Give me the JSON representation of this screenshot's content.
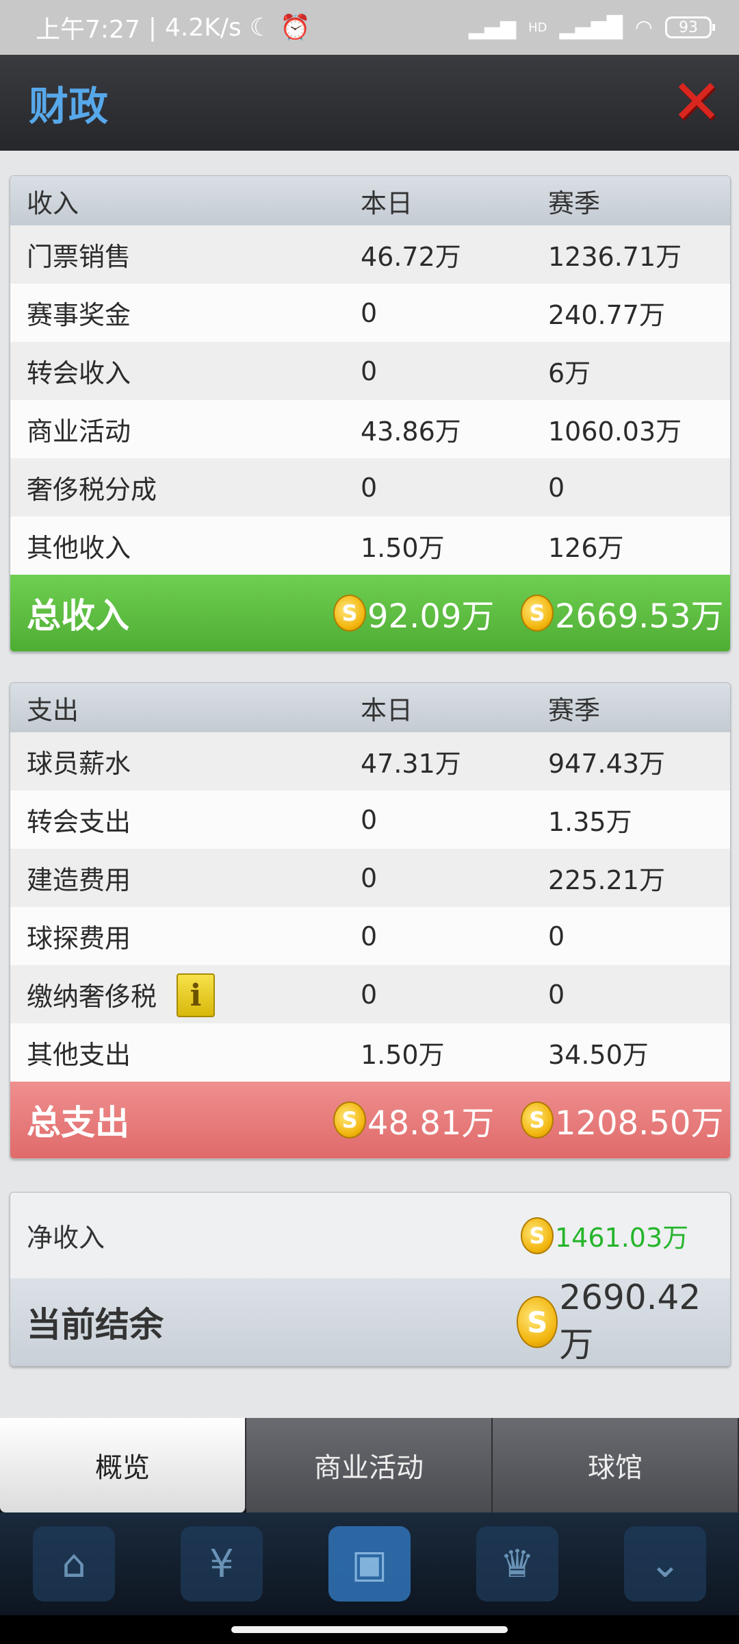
{
  "status_bar": {
    "time": "上午7:27",
    "speed": "4.2K/s",
    "battery": "93",
    "network": "HD"
  },
  "header": {
    "title": "财政"
  },
  "income": {
    "headers": [
      "收入",
      "本日",
      "赛季"
    ],
    "rows": [
      {
        "label": "门票销售",
        "day": "46.72万",
        "season": "1236.71万"
      },
      {
        "label": "赛事奖金",
        "day": "0",
        "season": "240.77万"
      },
      {
        "label": "转会收入",
        "day": "0",
        "season": "6万"
      },
      {
        "label": "商业活动",
        "day": "43.86万",
        "season": "1060.03万"
      },
      {
        "label": "奢侈税分成",
        "day": "0",
        "season": "0"
      },
      {
        "label": "其他收入",
        "day": "1.50万",
        "season": "126万"
      }
    ],
    "total": {
      "label": "总收入",
      "day": "92.09万",
      "season": "2669.53万"
    }
  },
  "expense": {
    "headers": [
      "支出",
      "本日",
      "赛季"
    ],
    "rows": [
      {
        "label": "球员薪水",
        "day": "47.31万",
        "season": "947.43万"
      },
      {
        "label": "转会支出",
        "day": "0",
        "season": "1.35万"
      },
      {
        "label": "建造费用",
        "day": "0",
        "season": "225.21万"
      },
      {
        "label": "球探费用",
        "day": "0",
        "season": "0"
      },
      {
        "label": "缴纳奢侈税",
        "day": "0",
        "season": "0"
      },
      {
        "label": "其他支出",
        "day": "1.50万",
        "season": "34.50万"
      }
    ],
    "total": {
      "label": "总支出",
      "day": "48.81万",
      "season": "1208.50万"
    }
  },
  "summary": {
    "net_label": "净收入",
    "net_value": "1461.03万",
    "balance_label": "当前结余",
    "balance_value": "2690.42万"
  },
  "coin_glyph": "S",
  "info_glyph": "i",
  "close_glyph": "✕",
  "tabs": [
    {
      "label": "概览",
      "active": true
    },
    {
      "label": "商业活动",
      "active": false
    },
    {
      "label": "球馆",
      "active": false
    }
  ],
  "colors": {
    "title_blue": "#57a8ea",
    "income_green": "#5cbd3f",
    "expense_red": "#e57777",
    "net_green": "#25b52a"
  }
}
